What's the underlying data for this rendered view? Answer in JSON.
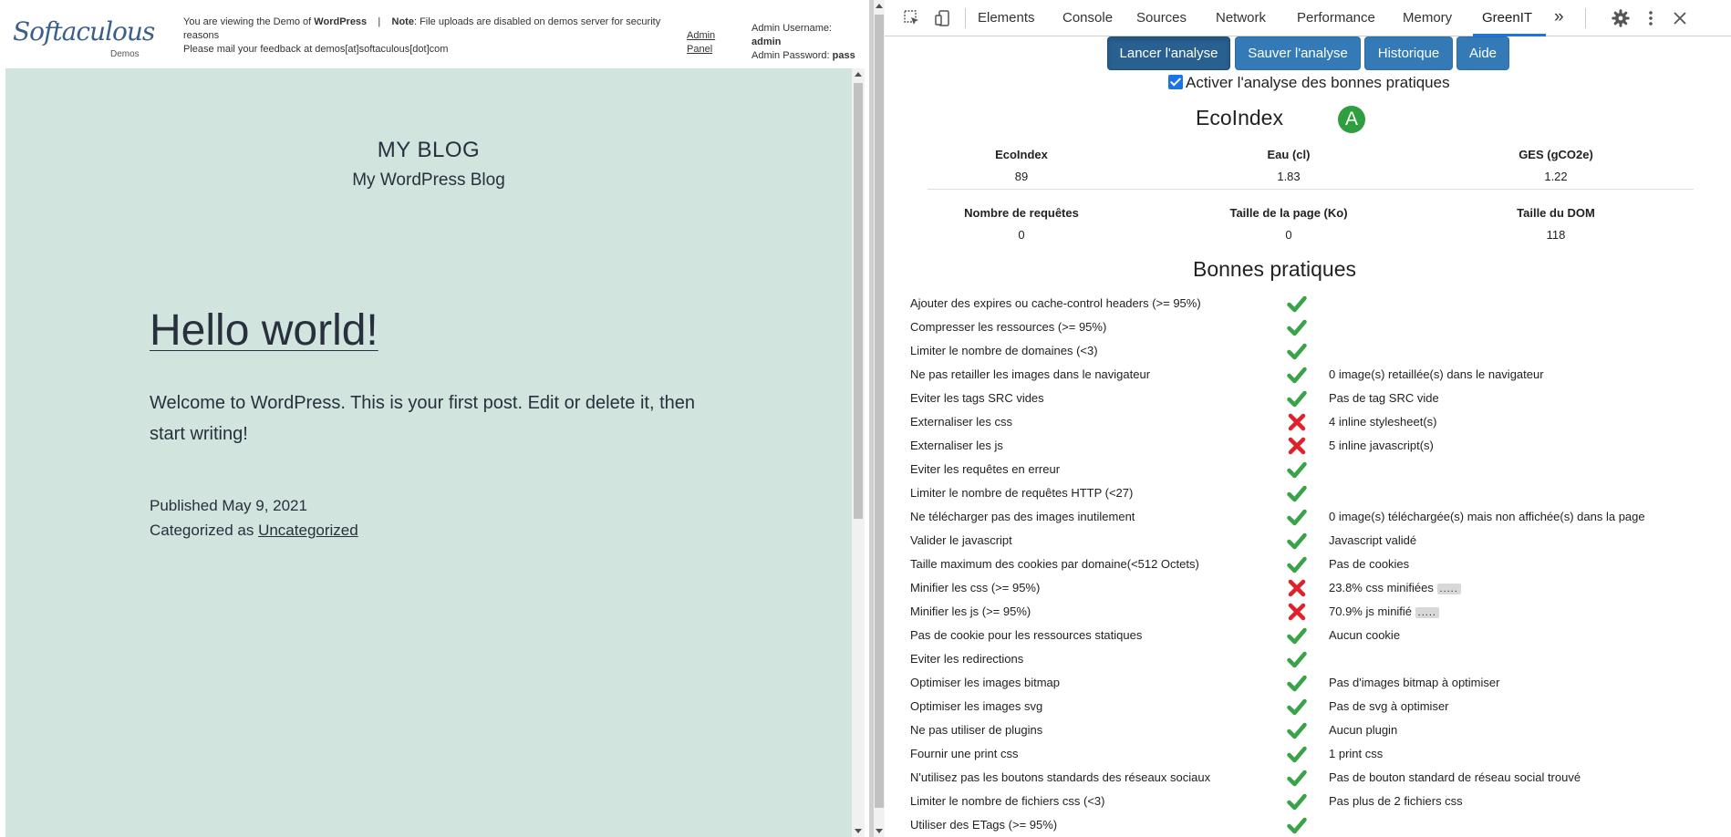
{
  "demo_bar": {
    "logo_text": "Softaculous",
    "logo_sub": "Demos",
    "msg_prefix": "You are viewing the Demo of",
    "msg_product": "WordPress",
    "msg_sep": "|",
    "msg_note_label": "Note",
    "msg_note": ": File uploads are disabled on demos server for security reasons",
    "msg_feedback": "Please mail your feedback at demos[at]softaculous[dot]com",
    "admin_panel": "Admin Panel",
    "admin_username_label": "Admin Username:",
    "admin_username": "admin",
    "admin_password_label": "Admin Password:",
    "admin_password": "pass"
  },
  "blog": {
    "site_title": "MY BLOG",
    "site_description": "My WordPress Blog",
    "post_title": "Hello world!",
    "post_body": "Welcome to WordPress. This is your first post. Edit or delete it, then start writing!",
    "published_label": "Published",
    "published_date": "May 9, 2021",
    "categorized_label": "Categorized as",
    "category": "Uncategorized"
  },
  "devtools": {
    "tabs": [
      "Elements",
      "Console",
      "Sources",
      "Network",
      "Performance",
      "Memory",
      "GreenIT"
    ],
    "active_tab": "GreenIT",
    "more_tabs": "»"
  },
  "greenit": {
    "buttons": {
      "analyze": "Lancer l'analyse",
      "save": "Sauver l'analyse",
      "history": "Historique",
      "help": "Aide"
    },
    "checkbox_label": "Activer l'analyse des bonnes pratiques",
    "checkbox_checked": true,
    "ecoindex_title": "EcoIndex",
    "ecoindex_grade": "A",
    "grade_color": "#2e9e3e",
    "metrics": [
      {
        "label": "EcoIndex",
        "value": "89"
      },
      {
        "label": "Eau (cl)",
        "value": "1.83"
      },
      {
        "label": "GES (gCO2e)",
        "value": "1.22"
      },
      {
        "label": "Nombre de requêtes",
        "value": "0"
      },
      {
        "label": "Taille de la page (Ko)",
        "value": "0"
      },
      {
        "label": "Taille du DOM",
        "value": "118"
      }
    ],
    "practices_title": "Bonnes pratiques",
    "practices": [
      {
        "label": "Ajouter des expires ou cache-control headers (>= 95%)",
        "ok": true,
        "comment": ""
      },
      {
        "label": "Compresser les ressources (>= 95%)",
        "ok": true,
        "comment": ""
      },
      {
        "label": "Limiter le nombre de domaines (<3)",
        "ok": true,
        "comment": ""
      },
      {
        "label": "Ne pas retailler les images dans le navigateur",
        "ok": true,
        "comment": "0 image(s) retaillée(s) dans le navigateur"
      },
      {
        "label": "Eviter les tags SRC vides",
        "ok": true,
        "comment": "Pas de tag SRC vide"
      },
      {
        "label": "Externaliser les css",
        "ok": false,
        "comment": "4 inline stylesheet(s)"
      },
      {
        "label": "Externaliser les js",
        "ok": false,
        "comment": "5 inline javascript(s)"
      },
      {
        "label": "Eviter les requêtes en erreur",
        "ok": true,
        "comment": ""
      },
      {
        "label": "Limiter le nombre de requêtes HTTP (<27)",
        "ok": true,
        "comment": ""
      },
      {
        "label": "Ne télécharger pas des images inutilement",
        "ok": true,
        "comment": "0 image(s) téléchargée(s) mais non affichée(s) dans la page"
      },
      {
        "label": "Valider le javascript",
        "ok": true,
        "comment": "Javascript validé"
      },
      {
        "label": "Taille maximum des cookies par domaine(<512 Octets)",
        "ok": true,
        "comment": "Pas de cookies"
      },
      {
        "label": "Minifier les css (>= 95%)",
        "ok": false,
        "comment": "23.8% css minifiées",
        "more": "....."
      },
      {
        "label": "Minifier les js (>= 95%)",
        "ok": false,
        "comment": "70.9% js minifié",
        "more": "....."
      },
      {
        "label": "Pas de cookie pour les ressources statiques",
        "ok": true,
        "comment": "Aucun cookie"
      },
      {
        "label": "Eviter les redirections",
        "ok": true,
        "comment": ""
      },
      {
        "label": "Optimiser les images bitmap",
        "ok": true,
        "comment": "Pas d'images bitmap à optimiser"
      },
      {
        "label": "Optimiser les images svg",
        "ok": true,
        "comment": "Pas de svg à optimiser"
      },
      {
        "label": "Ne pas utiliser de plugins",
        "ok": true,
        "comment": "Aucun plugin"
      },
      {
        "label": "Fournir une print css",
        "ok": true,
        "comment": "1 print css"
      },
      {
        "label": "N'utilisez pas les boutons standards des réseaux sociaux",
        "ok": true,
        "comment": "Pas de bouton standard de réseau social trouvé"
      },
      {
        "label": "Limiter le nombre de fichiers css (<3)",
        "ok": true,
        "comment": "Pas plus de 2 fichiers css"
      },
      {
        "label": "Utiliser des ETags (>= 95%)",
        "ok": true,
        "comment": ""
      }
    ]
  },
  "colors": {
    "ok": "#3aa34a",
    "fail": "#e0202a",
    "button": "#337ab7",
    "wp_background": "#d1e4dd"
  }
}
